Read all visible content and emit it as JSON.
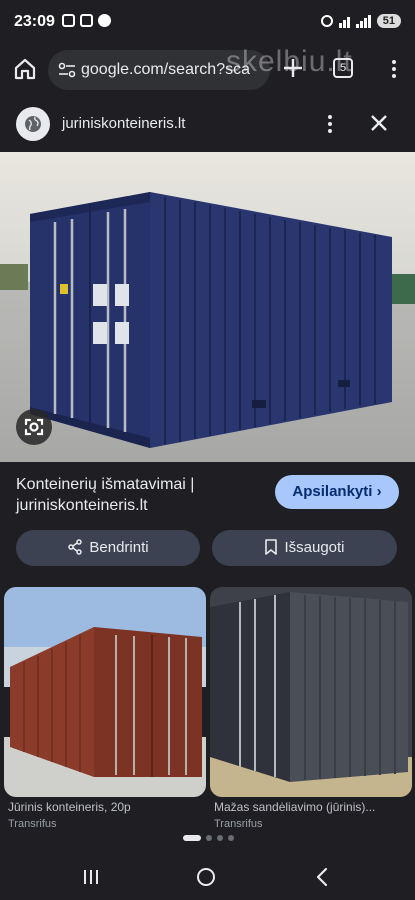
{
  "status_bar": {
    "time": "23:09",
    "battery": "51"
  },
  "browser": {
    "url": "google.com/search?sca",
    "watermark": "skelbiu.lt",
    "tab_count": "5"
  },
  "lens": {
    "site_name": "juriniskonteineris.lt",
    "result_title": "Konteinerių išmatavimai | juriniskonteineris.lt",
    "visit_label": "Apsilankyti",
    "share_label": "Bendrinti",
    "save_label": "Išsaugoti"
  },
  "related": [
    {
      "caption": "Jūrinis konteineris, 20p",
      "source": "Transrifus"
    },
    {
      "caption": "Mažas sandėliavimo (jūrinis)...",
      "source": "Transrifus"
    }
  ],
  "colors": {
    "background": "#1f1f23",
    "accent": "#a8c7fa",
    "button": "#3c4251",
    "container_blue": "#27346b",
    "container_rust": "#8b3b2a",
    "container_gray": "#4a4e56"
  }
}
